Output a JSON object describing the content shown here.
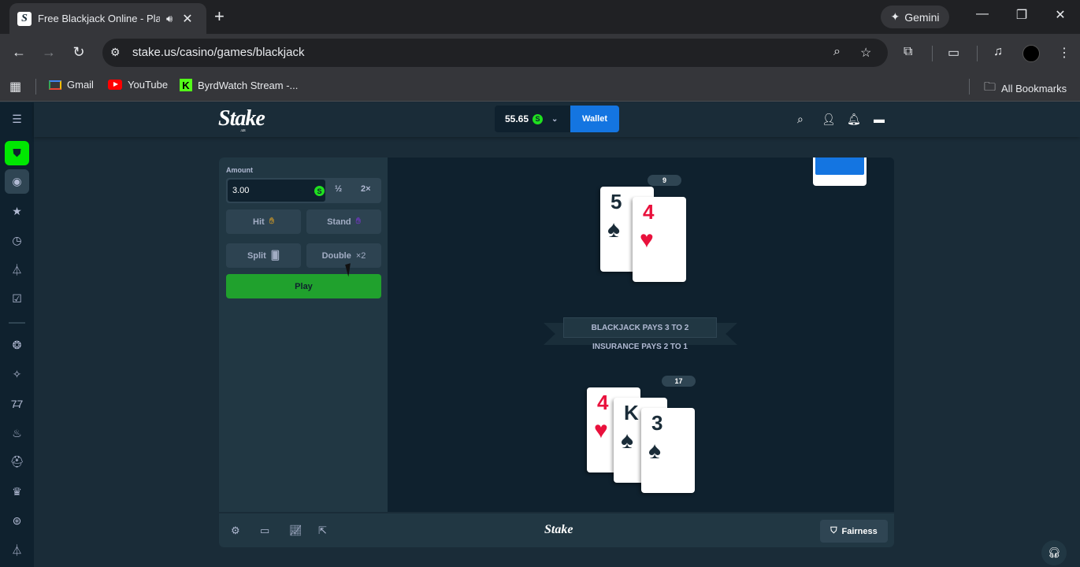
{
  "browser": {
    "tab_title": "Free Blackjack Online - Play",
    "tab_favicon": "S",
    "gemini_label": "Gemini",
    "url": "stake.us/casino/games/blackjack",
    "bookmarks": [
      {
        "label": "Gmail",
        "icon": "gmail-icon"
      },
      {
        "label": "YouTube",
        "icon": "youtube-icon"
      },
      {
        "label": "ByrdWatch Stream -...",
        "icon": "kick-icon"
      }
    ],
    "all_bookmarks_label": "All Bookmarks"
  },
  "stake": {
    "logo": "Stake",
    "logo_sub": ".us",
    "balance": "55.65",
    "coin_symbol": "S",
    "wallet_label": "Wallet",
    "accent_green": "#00e701",
    "accent_blue": "#1475e1"
  },
  "game": {
    "amount_label": "Amount",
    "amount_value": "3.00",
    "half_label": "½",
    "double_amount_label": "2×",
    "hit_label": "Hit",
    "stand_label": "Stand",
    "split_label": "Split",
    "double_label": "Double",
    "double_suffix": "×2",
    "play_label": "Play",
    "dealer": {
      "score": "9",
      "cards": [
        {
          "rank": "5",
          "suit": "♠",
          "color": "black"
        },
        {
          "rank": "4",
          "suit": "♥",
          "color": "red"
        }
      ]
    },
    "player": {
      "score": "17",
      "cards": [
        {
          "rank": "4",
          "suit": "♥",
          "color": "red"
        },
        {
          "rank": "K",
          "suit": "♠",
          "color": "black"
        },
        {
          "rank": "3",
          "suit": "♠",
          "color": "black"
        }
      ]
    },
    "banner_text": "BLACKJACK PAYS 3 TO 2",
    "insurance_text": "INSURANCE PAYS 2 TO 1",
    "footer_logo": "Stake",
    "fairness_label": "Fairness"
  }
}
